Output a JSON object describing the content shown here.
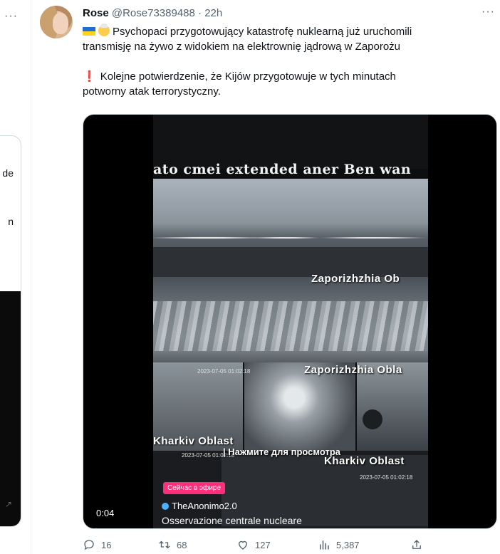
{
  "left_column": {
    "more_label": "···",
    "card_text_1": "de",
    "card_text_2": "n"
  },
  "tweet": {
    "author_name": "Rose",
    "author_handle": "@Rose73389488",
    "separator": "·",
    "time": "22h",
    "more_label": "···",
    "line1": "Psychopaci przygotowujący katastrofę nuklearną już uruchomili",
    "line2": "transmisję na żywo z widokiem na elektrownię jądrową w Zaporożu",
    "line3": "Kolejne potwierdzenie, że Kijów przygotowuje w tych minutach",
    "line4": "potworny atak terrorystyczny.",
    "exclamation": "❗"
  },
  "video": {
    "caption": "ato cmei extended aner Ben wan",
    "label_1": "Zaporizhzhia Ob",
    "label_2": "Zaporizhzhia Obla",
    "label_3": "Kharkiv Oblast",
    "label_4": "Kharkiv Oblast",
    "timestamp_1": "2023-07-05 01:02:18",
    "timestamp_2": "2023-07-05 01:02:18",
    "timestamp_3": "2023-07-05 01:02:18",
    "prompt": "| Нажмите для просмотра",
    "live_badge": "Сейчас в эфире",
    "channel": "TheAnonimo2.0",
    "subtitle": "Osservazione centrale nucleare",
    "duration": "0:04"
  },
  "actions": {
    "replies": "16",
    "retweets": "68",
    "likes": "127",
    "views": "5,387"
  }
}
